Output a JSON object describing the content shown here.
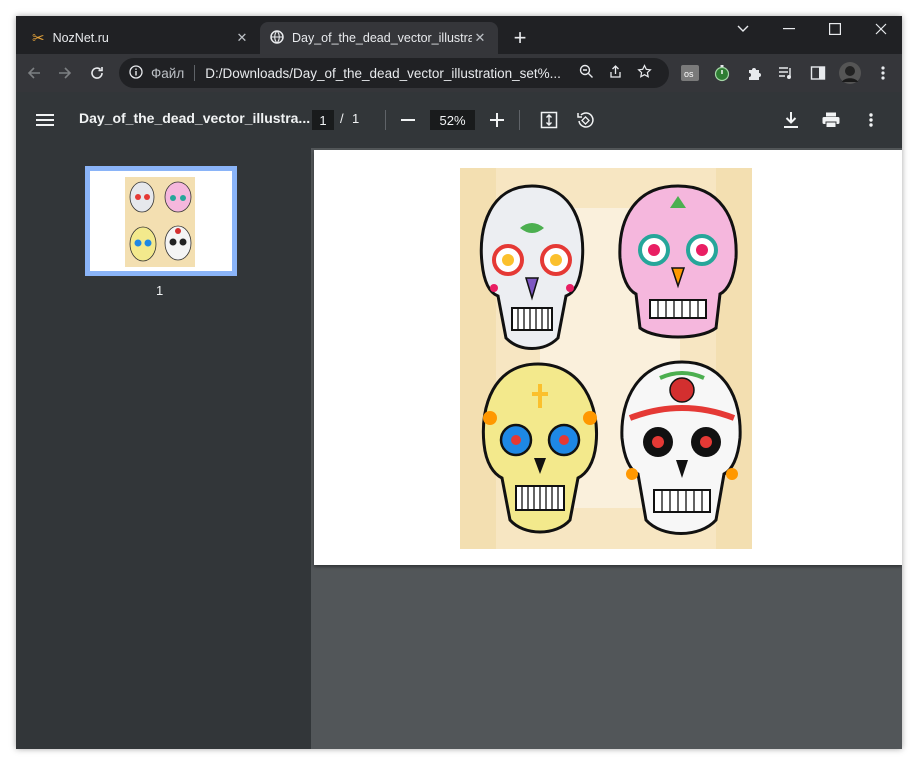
{
  "tabs": [
    {
      "title": "NozNet.ru",
      "icon": "tools-icon",
      "active": false
    },
    {
      "title": "Day_of_the_dead_vector_illustration",
      "icon": "globe-icon",
      "active": true
    }
  ],
  "address_bar": {
    "scheme_label": "Файл",
    "url": "D:/Downloads/Day_of_the_dead_vector_illustration_set%..."
  },
  "extensions": [
    "lastpass-icon",
    "timer-icon",
    "puzzle-icon",
    "playlist-icon",
    "sidebar-icon",
    "avatar"
  ],
  "pdf_viewer": {
    "title": "Day_of_the_dead_vector_illustra...",
    "current_page": "1",
    "page_separator": "/",
    "total_pages": "1",
    "zoom": "52%",
    "thumbnail_label": "1"
  },
  "colors": {
    "background_cream": "#f3dfb1",
    "skull_outline": "#111111",
    "accent_pink": "#f5b7dd",
    "accent_yellow": "#f3e98c"
  }
}
